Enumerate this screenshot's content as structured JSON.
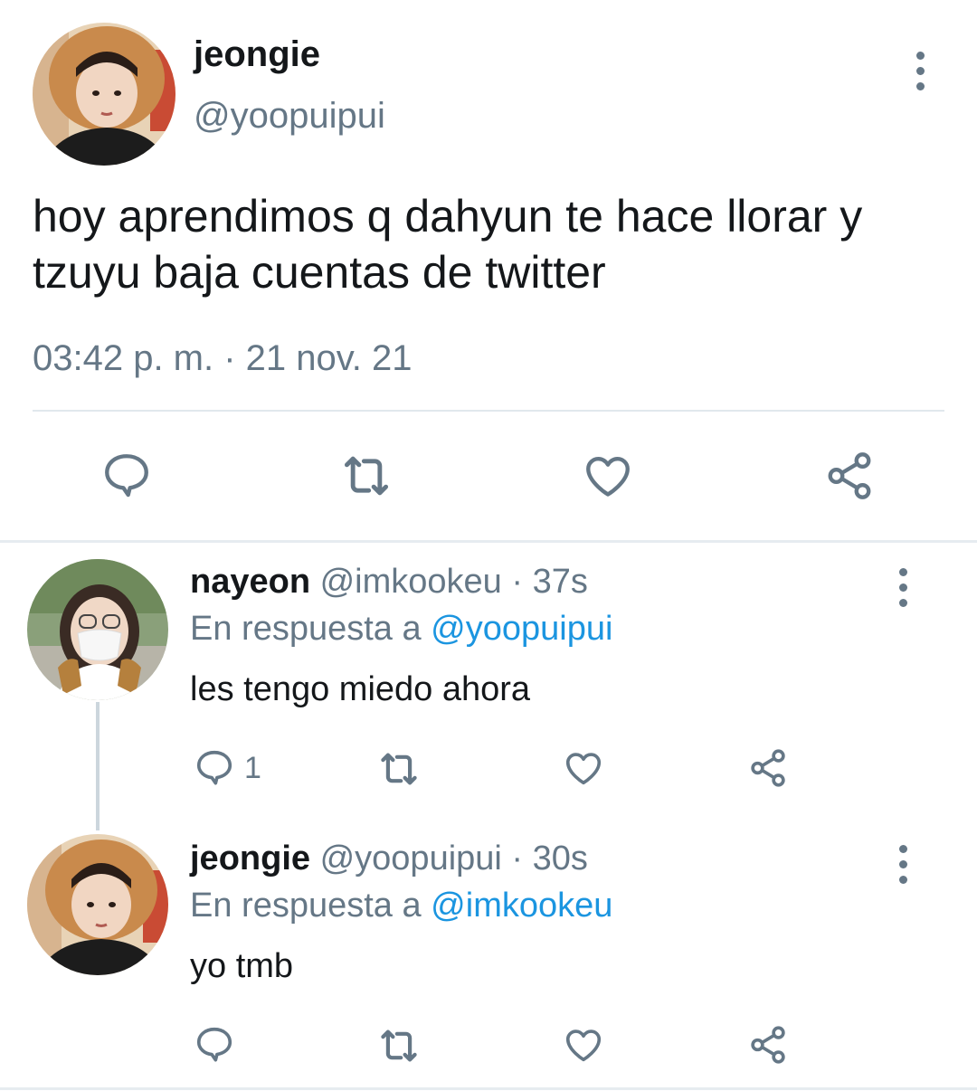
{
  "main_tweet": {
    "display_name": "jeongie",
    "handle": "@yoopuipui",
    "text_line1": "hoy aprendimos q dahyun te hace llorar y",
    "text_line2": "tzuyu baja cuentas de twitter",
    "timestamp": "03:42 p. m. · 21 nov. 21",
    "icons": [
      "reply-icon",
      "retweet-icon",
      "like-icon",
      "share-icon"
    ]
  },
  "replies": [
    {
      "display_name": "nayeon",
      "handle": "@imkookeu",
      "time": "· 37s",
      "replying_prefix": "En respuesta a",
      "replying_to": "@yoopuipui",
      "text": "les tengo miedo ahora",
      "reply_count": "1"
    },
    {
      "display_name": "jeongie",
      "handle": "@yoopuipui",
      "time": "· 30s",
      "replying_prefix": "En respuesta a",
      "replying_to": "@imkookeu",
      "text": "yo tmb",
      "reply_count": ""
    }
  ],
  "colors": {
    "text": "#14171a",
    "secondary": "#657786",
    "link": "#1b95e0",
    "divider": "#e1e8ed"
  }
}
